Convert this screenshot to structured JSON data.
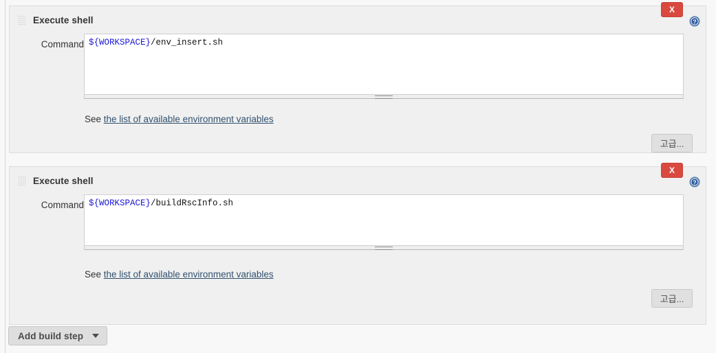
{
  "page": {
    "background_color": "#f8f8f8",
    "panel_color": "#f0f0f0"
  },
  "build_steps": [
    {
      "title": "Execute shell",
      "grip_icon": "drag-grip-icon",
      "delete_label": "X",
      "delete_color": "#d9493f",
      "help_icon": "help-icon",
      "field_label": "Command",
      "command_var": "${WORKSPACE}",
      "command_rest": "/env_insert.sh",
      "see_prefix": "See ",
      "see_link": "the list of available environment variables",
      "advanced_label": "고급..."
    },
    {
      "title": "Execute shell",
      "grip_icon": "drag-grip-icon",
      "delete_label": "X",
      "delete_color": "#d9493f",
      "help_icon": "help-icon",
      "field_label": "Command",
      "command_var": "${WORKSPACE}",
      "command_rest": "/buildRscInfo.sh",
      "see_prefix": "See ",
      "see_link": "the list of available environment variables",
      "advanced_label": "고급..."
    }
  ],
  "footer": {
    "add_build_step_label": "Add build step",
    "caret_icon": "chevron-down-icon"
  }
}
